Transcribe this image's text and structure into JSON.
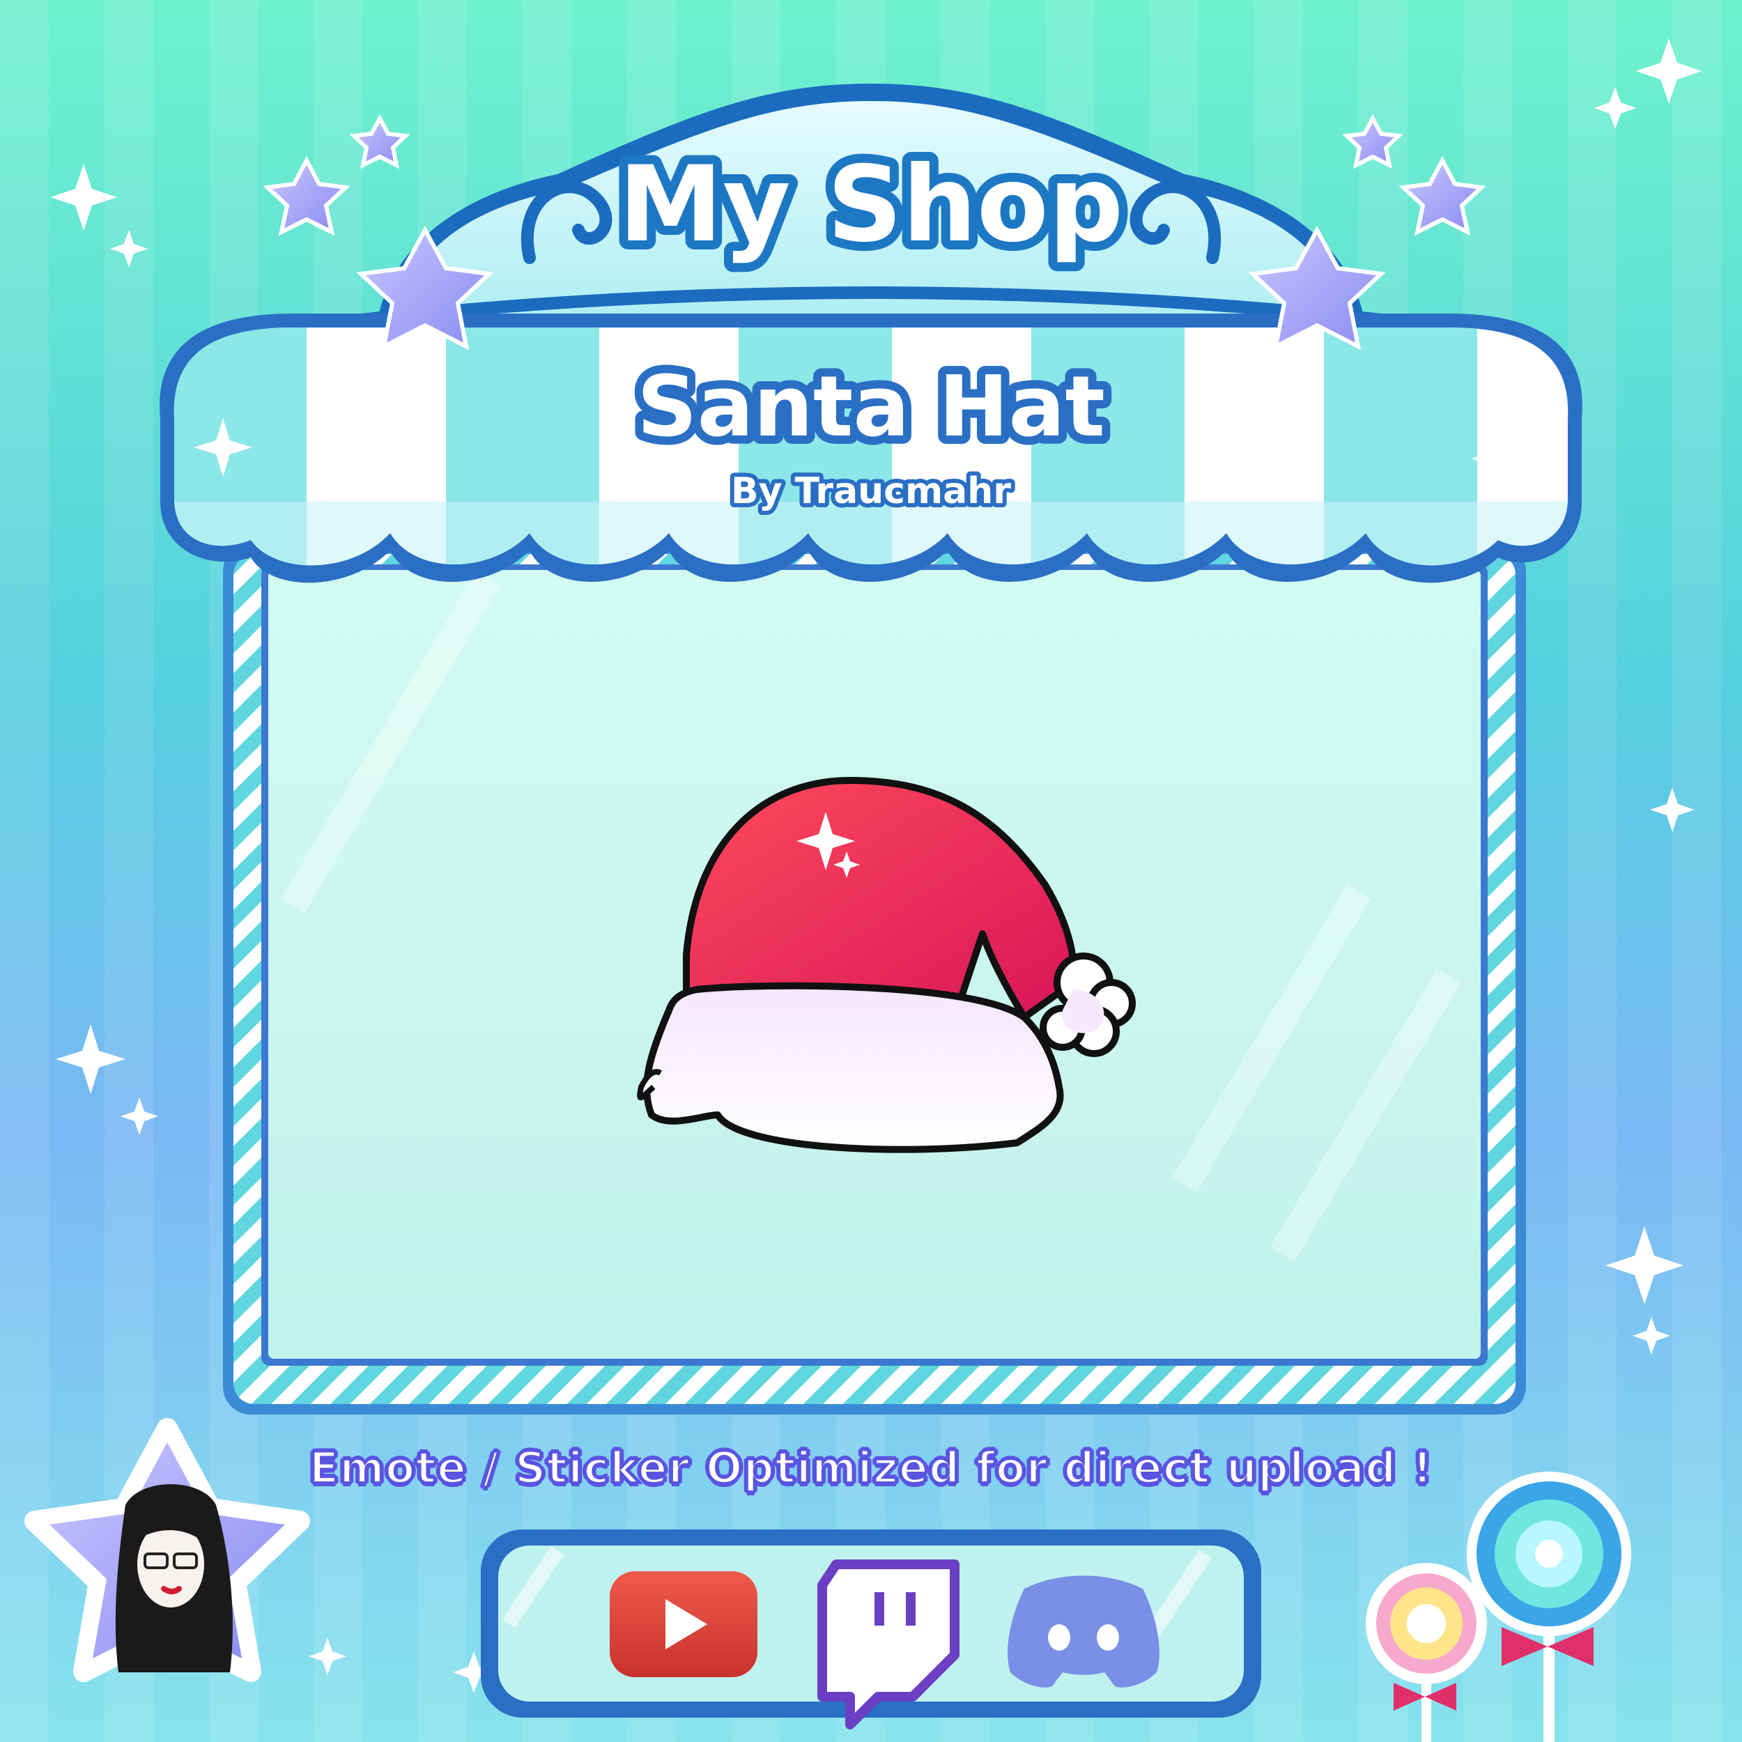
{
  "header": {
    "shop_title": "My Shop",
    "product_title": "Santa Hat",
    "author": "By Traucmahr"
  },
  "product": {
    "icon": "santa-hat-icon",
    "color": "#f0244a"
  },
  "footer": {
    "note": "Emote / Sticker Optimized for direct upload !"
  },
  "social_links": [
    {
      "icon": "youtube-icon",
      "color": "#e0443a"
    },
    {
      "icon": "twitch-icon",
      "color": "#6b3fc4"
    },
    {
      "icon": "discord-icon",
      "color": "#7a8fe6"
    }
  ],
  "colors": {
    "awning_blue": "#2a6fc4",
    "awning_aqua": "#7fe6e6",
    "panel": "#cdf7ee"
  }
}
